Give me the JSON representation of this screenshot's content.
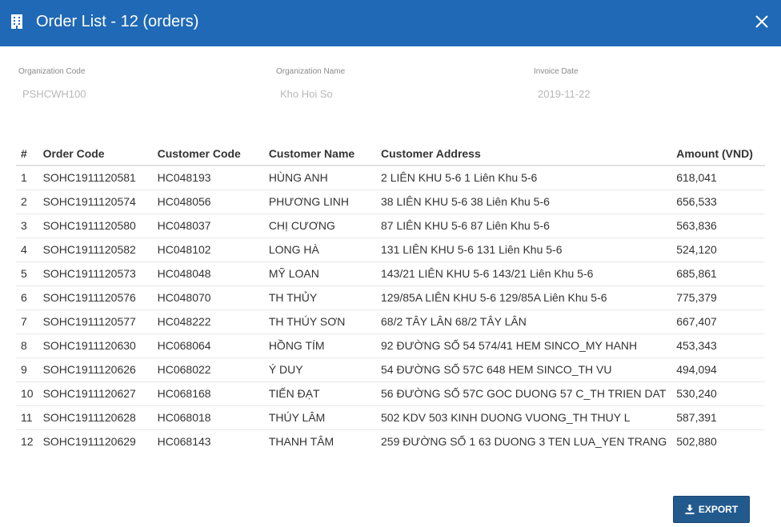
{
  "dialog": {
    "title": "Order List - 12 (orders)",
    "header_color": "#1f69b6",
    "icons": {
      "header": "building-icon",
      "close": "close-icon",
      "export": "download-icon"
    }
  },
  "info": {
    "org_code_label": "Organization Code",
    "org_code_value": "PSHCWH100",
    "org_name_label": "Organization Name",
    "org_name_value": "Kho Hoi So",
    "invoice_date_label": "Invoice Date",
    "invoice_date_value": "2019-11-22"
  },
  "table": {
    "headers": [
      "#",
      "Order Code",
      "Customer Code",
      "Customer Name",
      "Customer Address",
      "Amount (VND)"
    ],
    "rows": [
      [
        "1",
        "SOHC1911120581",
        "HC048193",
        "HÙNG ANH",
        "2 LIÊN KHU 5-6 1 Liên Khu 5-6",
        "618,041"
      ],
      [
        "2",
        "SOHC1911120574",
        "HC048056",
        "PHƯƠNG LINH",
        "38 LIÊN KHU 5-6 38 Liên Khu 5-6",
        "656,533"
      ],
      [
        "3",
        "SOHC1911120580",
        "HC048037",
        "CHỊ CƯƠNG",
        "87 LIÊN KHU 5-6 87 Liên Khu 5-6",
        "563,836"
      ],
      [
        "4",
        "SOHC1911120582",
        "HC048102",
        "LONG HÀ",
        "131 LIÊN KHU 5-6 131 Liên Khu 5-6",
        "524,120"
      ],
      [
        "5",
        "SOHC1911120573",
        "HC048048",
        "MỸ LOAN",
        "143/21 LIÊN KHU 5-6 143/21 Liên Khu 5-6",
        "685,861"
      ],
      [
        "6",
        "SOHC1911120576",
        "HC048070",
        "TH THỦY",
        "129/85A LIÊN KHU 5-6 129/85A Liên Khu 5-6",
        "775,379"
      ],
      [
        "7",
        "SOHC1911120577",
        "HC048222",
        "TH THÚY SƠN",
        "68/2 TÂY LÂN 68/2 TÂY LÂN",
        "667,407"
      ],
      [
        "8",
        "SOHC1911120630",
        "HC068064",
        "HỒNG TÍM",
        "92 ĐƯỜNG SỐ 54 574/41 HEM SINCO_MY HANH",
        "453,343"
      ],
      [
        "9",
        "SOHC1911120626",
        "HC068022",
        "Ý DUY",
        "54 ĐƯỜNG SỐ 57C 648 HEM SINCO_TH VU",
        "494,094"
      ],
      [
        "10",
        "SOHC1911120627",
        "HC068168",
        "TIẾN ĐẠT",
        "56 ĐƯỜNG SỐ 57C GOC DUONG 57 C_TH TRIEN DAT",
        "530,240"
      ],
      [
        "11",
        "SOHC1911120628",
        "HC068018",
        "THÚY LÂM",
        "502 KDV 503 KINH DUONG VUONG_TH THUY L",
        "587,391"
      ],
      [
        "12",
        "SOHC1911120629",
        "HC068143",
        "THANH TÂM",
        "259 ĐƯỜNG SỐ 1 63 DUONG 3 TEN LUA_YEN TRANG",
        "502,880"
      ]
    ]
  },
  "actions": {
    "export_label": "EXPORT"
  }
}
